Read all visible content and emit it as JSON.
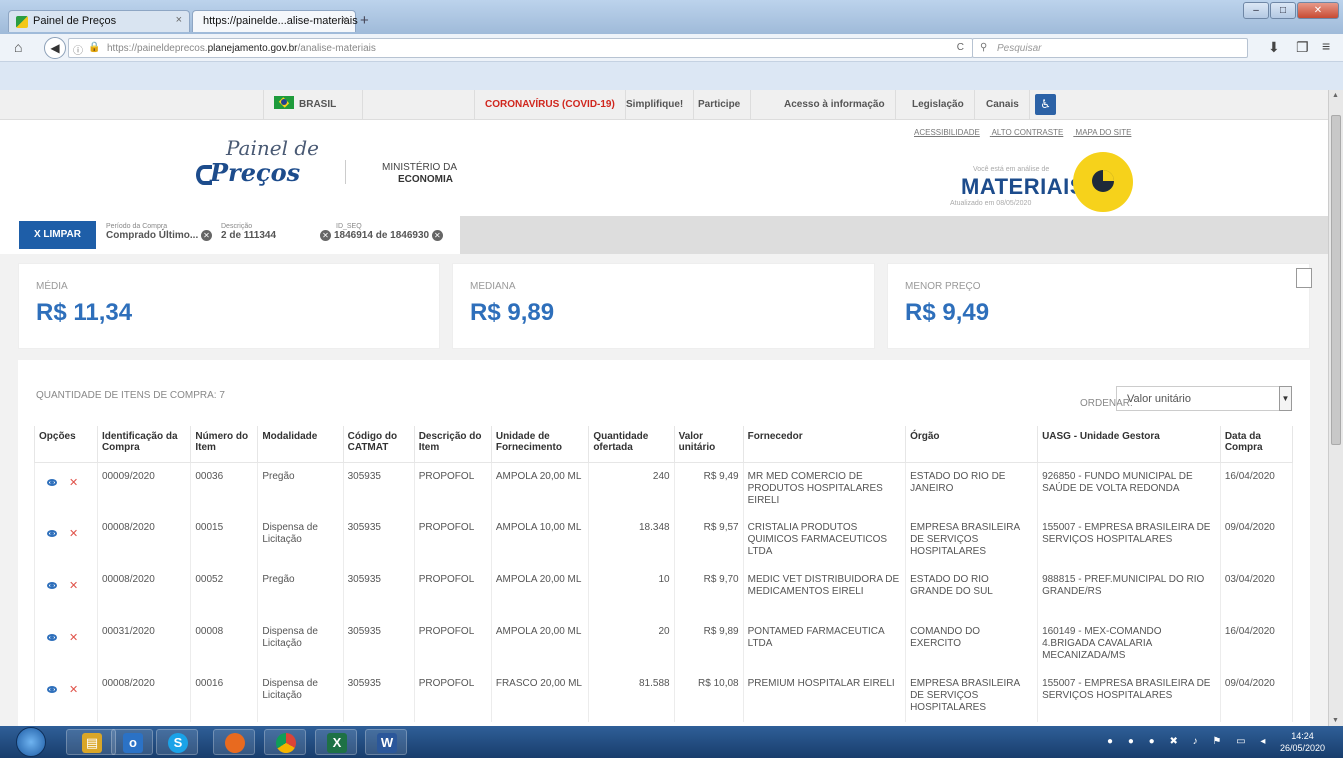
{
  "browser": {
    "tabs": [
      {
        "label": "Painel de Preços",
        "close": "×"
      },
      {
        "label": "https://painelde...alise-materiais",
        "close": "×"
      }
    ],
    "new_tab": "+",
    "url_prefix": "https://paineldeprecos.",
    "url_domain": "planejamento.gov.br",
    "url_path": "/analise-materiais",
    "search_placeholder": "Pesquisar",
    "window_buttons": [
      "–",
      "□",
      "✕"
    ],
    "nav_icons": {
      "home": "⌂",
      "reload": "C",
      "download": "⬇",
      "sidebar": "❐",
      "menu": "≡"
    }
  },
  "govbar": {
    "brasil": "BRASIL",
    "items": [
      "CORONAVÍRUS (COVID-19)",
      "Simplifique!",
      "Participe",
      "Acesso à informação",
      "Legislação",
      "Canais"
    ]
  },
  "header": {
    "logo_top": "Painel de",
    "logo_bottom": "Preços",
    "ministry_line1": "MINISTÉRIO DA",
    "ministry_line2": "ECONOMIA",
    "links": [
      "ACESSIBILIDADE",
      "ALTO CONTRASTE",
      "MAPA DO SITE"
    ],
    "analysis_label": "Você está em análise de",
    "section": "MATERIAIS",
    "updated": "Atualizado em 08/05/2020"
  },
  "filters": {
    "clear_button": "X  LIMPAR",
    "items": [
      {
        "label": "Período da Compra",
        "value": "Comprado Último..."
      },
      {
        "label": "Descrição",
        "value": "2 de 111344"
      },
      {
        "label": "ID_SEQ",
        "value": "1846914 de 1846930"
      }
    ]
  },
  "summary": {
    "mean_label": "MÉDIA",
    "mean_value": "R$ 11,34",
    "median_label": "MEDIANA",
    "median_value": "R$ 9,89",
    "min_label": "MENOR PREÇO",
    "min_value": "R$ 9,49"
  },
  "table": {
    "count_label": "QUANTIDADE DE ITENS DE COMPRA: 7",
    "sort_label": "ORDENAR:",
    "sort_value": "Valor unitário",
    "headers": [
      "Opções",
      "Identificação da Compra",
      "Número do Item",
      "Modalidade",
      "Código do CATMAT",
      "Descrição do Item",
      "Unidade de Fornecimento",
      "Quantidade ofertada",
      "Valor unitário",
      "Fornecedor",
      "Órgão",
      "UASG - Unidade Gestora",
      "Data da Compra"
    ],
    "rows": [
      {
        "id": "00009/2020",
        "item": "00036",
        "mod": "Pregão",
        "catmat": "305935",
        "desc": "PROPOFOL",
        "unit": "AMPOLA 20,00 ML",
        "qty": "240",
        "price": "R$ 9,49",
        "supplier": "MR MED COMERCIO DE PRODUTOS HOSPITALARES EIRELI",
        "org": "ESTADO DO RIO DE JANEIRO",
        "uasg": "926850 - FUNDO MUNICIPAL DE SAÚDE DE VOLTA REDONDA",
        "date": "16/04/2020"
      },
      {
        "id": "00008/2020",
        "item": "00015",
        "mod": "Dispensa de Licitação",
        "catmat": "305935",
        "desc": "PROPOFOL",
        "unit": "AMPOLA 10,00 ML",
        "qty": "18.348",
        "price": "R$ 9,57",
        "supplier": "CRISTALIA PRODUTOS QUIMICOS FARMACEUTICOS LTDA",
        "org": "EMPRESA BRASILEIRA DE SERVIÇOS HOSPITALARES",
        "uasg": "155007 - EMPRESA BRASILEIRA DE SERVIÇOS HOSPITALARES",
        "date": "09/04/2020"
      },
      {
        "id": "00008/2020",
        "item": "00052",
        "mod": "Pregão",
        "catmat": "305935",
        "desc": "PROPOFOL",
        "unit": "AMPOLA 20,00 ML",
        "qty": "10",
        "price": "R$ 9,70",
        "supplier": "MEDIC VET DISTRIBUIDORA DE MEDICAMENTOS EIRELI",
        "org": "ESTADO DO RIO GRANDE DO SUL",
        "uasg": "988815 - PREF.MUNICIPAL DO RIO GRANDE/RS",
        "date": "03/04/2020"
      },
      {
        "id": "00031/2020",
        "item": "00008",
        "mod": "Dispensa de Licitação",
        "catmat": "305935",
        "desc": "PROPOFOL",
        "unit": "AMPOLA 20,00 ML",
        "qty": "20",
        "price": "R$ 9,89",
        "supplier": "PONTAMED FARMACEUTICA LTDA",
        "org": "COMANDO DO EXERCITO",
        "uasg": "160149 - MEX-COMANDO 4.BRIGADA CAVALARIA MECANIZADA/MS",
        "date": "16/04/2020"
      },
      {
        "id": "00008/2020",
        "item": "00016",
        "mod": "Dispensa de Licitação",
        "catmat": "305935",
        "desc": "PROPOFOL",
        "unit": "FRASCO 20,00 ML",
        "qty": "81.588",
        "price": "R$ 10,08",
        "supplier": "PREMIUM HOSPITALAR EIRELI",
        "org": "EMPRESA BRASILEIRA DE SERVIÇOS HOSPITALARES",
        "uasg": "155007 - EMPRESA BRASILEIRA DE SERVIÇOS HOSPITALARES",
        "date": "09/04/2020"
      }
    ]
  },
  "taskbar": {
    "time": "14:24",
    "date": "26/05/2020",
    "apps": [
      "explorer",
      "outlook",
      "skype",
      "firefox",
      "chrome",
      "excel",
      "word"
    ]
  },
  "colors": {
    "accent": "#2e6fbb",
    "button": "#1e5ea8",
    "covid": "#d0261d",
    "logo_yellow": "#f6d21b"
  }
}
